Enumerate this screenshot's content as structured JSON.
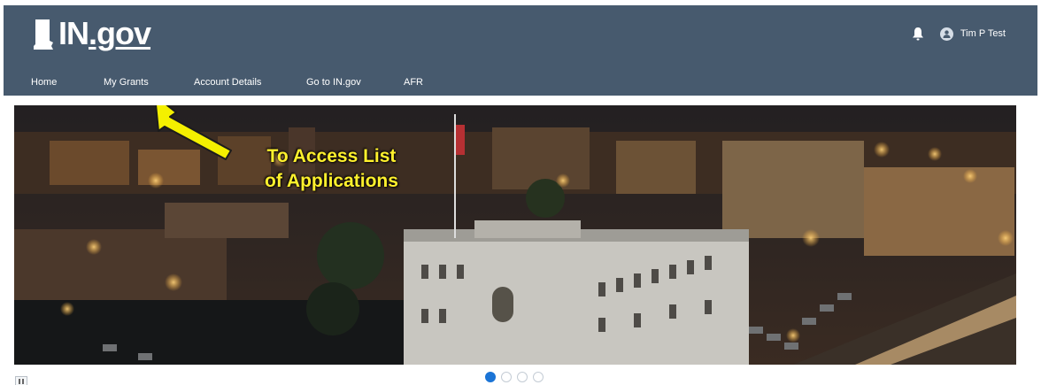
{
  "header": {
    "logo_text": "IN.gov",
    "logo_prefix": "IN",
    "logo_suffix": ".gov",
    "user_name": "Tim P Test",
    "bg_color": "#475a6e"
  },
  "nav": {
    "items": [
      {
        "label": "Home"
      },
      {
        "label": "My Grants"
      },
      {
        "label": "Account Details"
      },
      {
        "label": "Go to IN.gov"
      },
      {
        "label": "AFR"
      }
    ]
  },
  "hero": {
    "annotation_line1": "To Access List",
    "annotation_line2": "of Applications",
    "annotation_color": "#fff12d",
    "arrow_color": "#f4f000"
  },
  "carousel": {
    "slide_count": 4,
    "active_index": 0,
    "active_color": "#1b74d6"
  },
  "icons": {
    "bell": "bell-icon",
    "avatar": "user-avatar-icon",
    "pause": "pause-icon",
    "logo": "indiana-state-icon"
  }
}
